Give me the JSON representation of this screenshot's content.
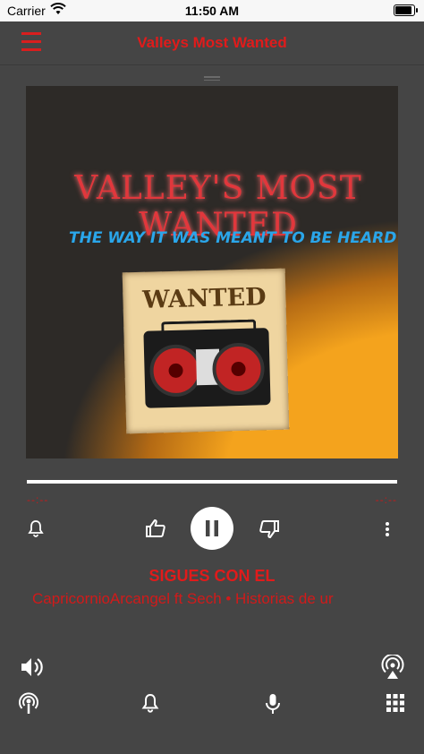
{
  "status": {
    "carrier": "Carrier",
    "time": "11:50 AM",
    "battery_level": 1.0
  },
  "header": {
    "title": "Valleys Most Wanted"
  },
  "artwork": {
    "title": "VALLEY'S MOST WANTED",
    "subtitle": "THE WAY IT WAS MEANT TO BE HEARD",
    "poster_text": "WANTED"
  },
  "player": {
    "progress": 1.0,
    "elapsed": "--:--",
    "remaining": "--:--",
    "song_title": "SIGUES CON EL",
    "artist_line": "CapricornioArcangel ft Sech • Historias de ur"
  },
  "icons": {
    "alarm": "bell-icon",
    "like": "thumbs-up-icon",
    "pause": "pause-icon",
    "dislike": "thumbs-down-icon",
    "more": "more-vertical-icon",
    "volume": "volume-icon",
    "airplay": "airplay-icon",
    "podcast": "podcast-icon",
    "bell": "bell-icon",
    "mic": "microphone-icon",
    "grid": "grid-icon"
  },
  "colors": {
    "accent": "#e01b1b",
    "background": "#454545"
  }
}
